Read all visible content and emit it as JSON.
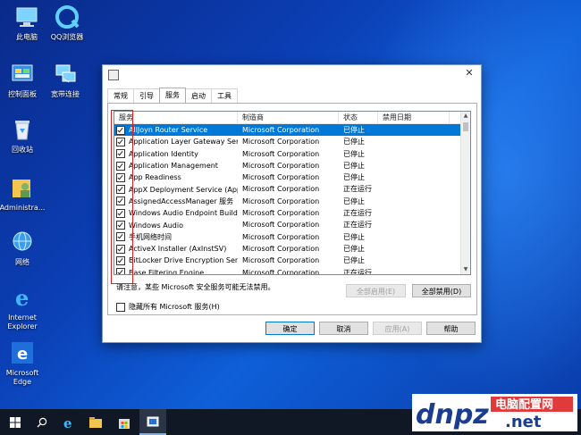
{
  "desktop": {
    "icons": [
      {
        "label": "此电脑"
      },
      {
        "label": "QQ浏览器"
      },
      {
        "label": "控制面板"
      },
      {
        "label": "宽带连接"
      },
      {
        "label": "回收站"
      },
      {
        "label": "Administra..."
      },
      {
        "label": "网络"
      },
      {
        "label": "Internet Explorer"
      },
      {
        "label": "Microsoft Edge"
      }
    ]
  },
  "dialog": {
    "close_glyph": "✕",
    "tabs": [
      "常规",
      "引导",
      "服务",
      "启动",
      "工具"
    ],
    "active_tab": "服务",
    "columns": [
      "服务",
      "制造商",
      "状态",
      "禁用日期"
    ],
    "rows": [
      {
        "service": "AllJoyn Router Service",
        "maker": "Microsoft Corporation",
        "status": "已停止",
        "date": ""
      },
      {
        "service": "Application Layer Gateway Service",
        "maker": "Microsoft Corporation",
        "status": "已停止",
        "date": ""
      },
      {
        "service": "Application Identity",
        "maker": "Microsoft Corporation",
        "status": "已停止",
        "date": ""
      },
      {
        "service": "Application Management",
        "maker": "Microsoft Corporation",
        "status": "已停止",
        "date": ""
      },
      {
        "service": "App Readiness",
        "maker": "Microsoft Corporation",
        "status": "已停止",
        "date": ""
      },
      {
        "service": "AppX Deployment Service (AppX...",
        "maker": "Microsoft Corporation",
        "status": "正在运行",
        "date": ""
      },
      {
        "service": "AssignedAccessManager 服务",
        "maker": "Microsoft Corporation",
        "status": "已停止",
        "date": ""
      },
      {
        "service": "Windows Audio Endpoint Builder",
        "maker": "Microsoft Corporation",
        "status": "正在运行",
        "date": ""
      },
      {
        "service": "Windows Audio",
        "maker": "Microsoft Corporation",
        "status": "正在运行",
        "date": ""
      },
      {
        "service": "手机网络时间",
        "maker": "Microsoft Corporation",
        "status": "已停止",
        "date": ""
      },
      {
        "service": "ActiveX Installer (AxInstSV)",
        "maker": "Microsoft Corporation",
        "status": "已停止",
        "date": ""
      },
      {
        "service": "BitLocker Drive Encryption Service",
        "maker": "Microsoft Corporation",
        "status": "已停止",
        "date": ""
      },
      {
        "service": "Base Filtering Engine",
        "maker": "Microsoft Corporation",
        "status": "正在运行",
        "date": ""
      }
    ],
    "note": "请注意，某些 Microsoft 安全服务可能无法禁用。",
    "enable_all": "全部启用(E)",
    "disable_all": "全部禁用(D)",
    "hide_ms": "隐藏所有 Microsoft 服务(H)",
    "ok": "确定",
    "cancel": "取消",
    "apply": "应用(A)",
    "help": "帮助"
  },
  "watermark": {
    "brand": "dnpz",
    "cn": "电脑配置网",
    "domain": ".net"
  },
  "colors": {
    "selection": "#0078d7",
    "highlight_box": "#e02020"
  }
}
